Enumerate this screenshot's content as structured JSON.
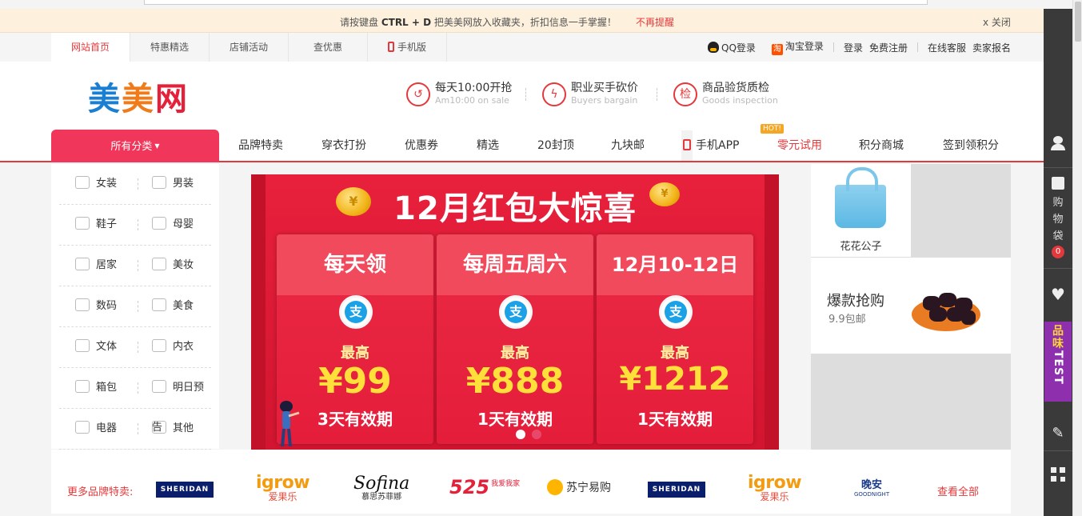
{
  "notice": {
    "text_prefix": "请按键盘 ",
    "shortcut": "CTRL + D",
    "text_suffix": " 把美美网放入收藏夹，折扣信息一手掌握！",
    "dismiss": "不再提醒",
    "close": "x 关闭"
  },
  "topbar": {
    "tabs": [
      {
        "label": "网站首页"
      },
      {
        "label": "特惠精选"
      },
      {
        "label": "店铺活动"
      },
      {
        "label": "查优惠"
      },
      {
        "label": "手机版"
      }
    ],
    "qq_login": "QQ登录",
    "taobao_login": "淘宝登录",
    "taobao_icon": "淘",
    "login": "登录",
    "register": "免费注册",
    "service": "在线客服",
    "seller": "卖家报名"
  },
  "header": {
    "logo": [
      "美",
      "美",
      "网"
    ],
    "promises": [
      {
        "icon": "clock-icon",
        "glyph": "↺",
        "title": "每天10:00开抢",
        "sub": "Am10:00 on sale"
      },
      {
        "icon": "lightning-icon",
        "glyph": "ϟ",
        "title": "职业买手砍价",
        "sub": "Buyers bargain"
      },
      {
        "icon": "inspect-icon",
        "glyph": "检",
        "title": "商品验货质检",
        "sub": "Goods inspection"
      }
    ]
  },
  "nav": {
    "all_categories": "所有分类",
    "items": [
      "品牌特卖",
      "穿衣打扮",
      "优惠券",
      "精选",
      "20封顶",
      "九块邮",
      "手机APP",
      "零元试用",
      "积分商城",
      "签到领积分"
    ],
    "hot": "HOT!"
  },
  "categories": [
    [
      "女装",
      "男装"
    ],
    [
      "鞋子",
      "母婴"
    ],
    [
      "居家",
      "美妆"
    ],
    [
      "数码",
      "美食"
    ],
    [
      "文体",
      "内衣"
    ],
    [
      "箱包",
      "明日预告"
    ],
    [
      "电器",
      "其他"
    ]
  ],
  "banner": {
    "title": "12月红包大惊喜",
    "coin": "¥",
    "cards": [
      {
        "head": "每天领",
        "max": "最高",
        "amount": "¥99",
        "valid": "3天有效期"
      },
      {
        "head": "每周五周六",
        "max": "最高",
        "amount": "¥888",
        "valid": "1天有效期"
      },
      {
        "head": "12月10-12日",
        "max": "最高",
        "amount": "¥1212",
        "valid": "1天有效期"
      }
    ],
    "active_slide": 1,
    "slide_count": 2
  },
  "side": {
    "bag_label": "花花公子",
    "hot_title": "爆款抢购",
    "hot_sub": "9.9包邮"
  },
  "brands": {
    "more": "更多品牌特卖:",
    "all": "查看全部",
    "sheridan": "SHERIDAN",
    "igrow_en": "igrow",
    "igrow_cn": "爱果乐",
    "sofina_en": "Sofina",
    "sofina_cn": "慕思苏菲娜",
    "n525": "525",
    "n525_sub": "我爱我家",
    "suning": "苏宁易购",
    "wanan": "晚安",
    "wanan_sub": "GOODNIGHT"
  },
  "sidebar": {
    "cart": [
      "购",
      "物",
      "袋"
    ],
    "cart_count": "0",
    "test_cn": [
      "品",
      "味"
    ],
    "test_en": "TEST"
  },
  "colors": {
    "accent": "#e4393c",
    "category_button": "#f0365a",
    "test_badge": "#8e2fae"
  }
}
